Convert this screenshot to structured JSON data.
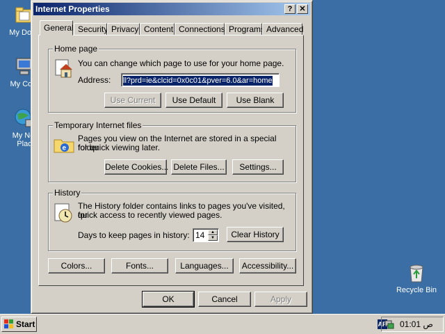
{
  "desktop": {
    "icons": [
      {
        "label": "My Docu"
      },
      {
        "label": "My Com"
      },
      {
        "label": "My Net",
        "label2": "Plac"
      },
      {
        "label": "Recycle Bin"
      }
    ]
  },
  "window": {
    "title": "Internet Properties",
    "help_btn": "?",
    "close_btn": "✕",
    "tabs": [
      "General",
      "Security",
      "Privacy",
      "Content",
      "Connections",
      "Programs",
      "Advanced"
    ],
    "active_tab": "General",
    "home_page": {
      "title": "Home page",
      "text": "You can change which page to use for your home page.",
      "address_label": "Address:",
      "address_value": "ll?prd=ie&clcid=0x0c01&pver=6.0&ar=home",
      "use_current": "Use Current",
      "use_default": "Use Default",
      "use_blank": "Use Blank"
    },
    "temp_files": {
      "title": "Temporary Internet files",
      "text1": "Pages you view on the Internet are stored in a special folder",
      "text2": "for quick viewing later.",
      "delete_cookies": "Delete Cookies...",
      "delete_files": "Delete Files...",
      "settings": "Settings..."
    },
    "history": {
      "title": "History",
      "text1": "The History folder contains links to pages you've visited, for",
      "text2": "quick access to recently viewed pages.",
      "days_label": "Days to keep pages in history:",
      "days_value": "14",
      "clear_history": "Clear History"
    },
    "bottom_buttons": {
      "colors": "Colors...",
      "fonts": "Fonts...",
      "languages": "Languages...",
      "accessibility": "Accessibility..."
    },
    "ok": "OK",
    "cancel": "Cancel",
    "apply": "Apply"
  },
  "taskbar": {
    "start": "Start",
    "lang": "AR",
    "clock": "01:01 ص"
  },
  "colors": {
    "desktop": "#3a6ea5",
    "titlebar": "#0a246a",
    "face": "#d4d0c8"
  }
}
